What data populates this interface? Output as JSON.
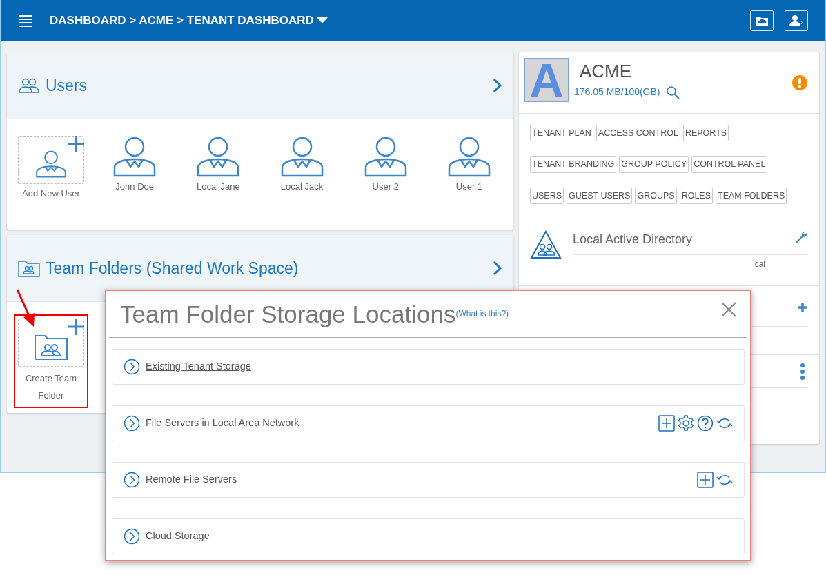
{
  "header": {
    "breadcrumb": "DASHBOARD > ACME > TENANT DASHBOARD"
  },
  "users_panel": {
    "title": "Users",
    "items": [
      {
        "name": "Add New User",
        "kind": "add"
      },
      {
        "name": "John Doe",
        "kind": "user"
      },
      {
        "name": "Local Jane",
        "kind": "user"
      },
      {
        "name": "Local Jack",
        "kind": "user"
      },
      {
        "name": "User 2",
        "kind": "user"
      },
      {
        "name": "User 1",
        "kind": "user"
      }
    ]
  },
  "team_folders_panel": {
    "title": "Team Folders (Shared Work Space)",
    "items": [
      {
        "name": "Create Team Folder",
        "kind": "add",
        "highlighted": true
      }
    ]
  },
  "tenant": {
    "initial": "A",
    "name": "ACME",
    "quota": "176.05 MB/100(GB)",
    "button_rows": [
      [
        "TENANT PLAN",
        "ACCESS CONTROL",
        "REPORTS"
      ],
      [
        "TENANT BRANDING",
        "GROUP POLICY",
        "CONTROL PANEL"
      ],
      [
        "USERS",
        "GUEST USERS",
        "GROUPS",
        "ROLES",
        "TEAM FOLDERS"
      ]
    ]
  },
  "directory": {
    "title": "Local Active Directory",
    "detail": "cal"
  },
  "dialog": {
    "title": "Team Folder Storage Locations",
    "help_link": "(What is this?)",
    "rows": [
      {
        "label": "Existing Tenant Storage",
        "link": true,
        "actions": []
      },
      {
        "label": "File Servers in Local Area Network",
        "link": false,
        "actions": [
          {
            "kind": "add"
          },
          {
            "kind": "settings"
          },
          {
            "kind": "help"
          },
          {
            "kind": "refresh"
          }
        ]
      },
      {
        "label": "Remote File Servers",
        "link": false,
        "actions": [
          {
            "kind": "add"
          },
          {
            "kind": "refresh"
          }
        ]
      },
      {
        "label": "Cloud Storage",
        "link": false,
        "actions": []
      }
    ]
  }
}
